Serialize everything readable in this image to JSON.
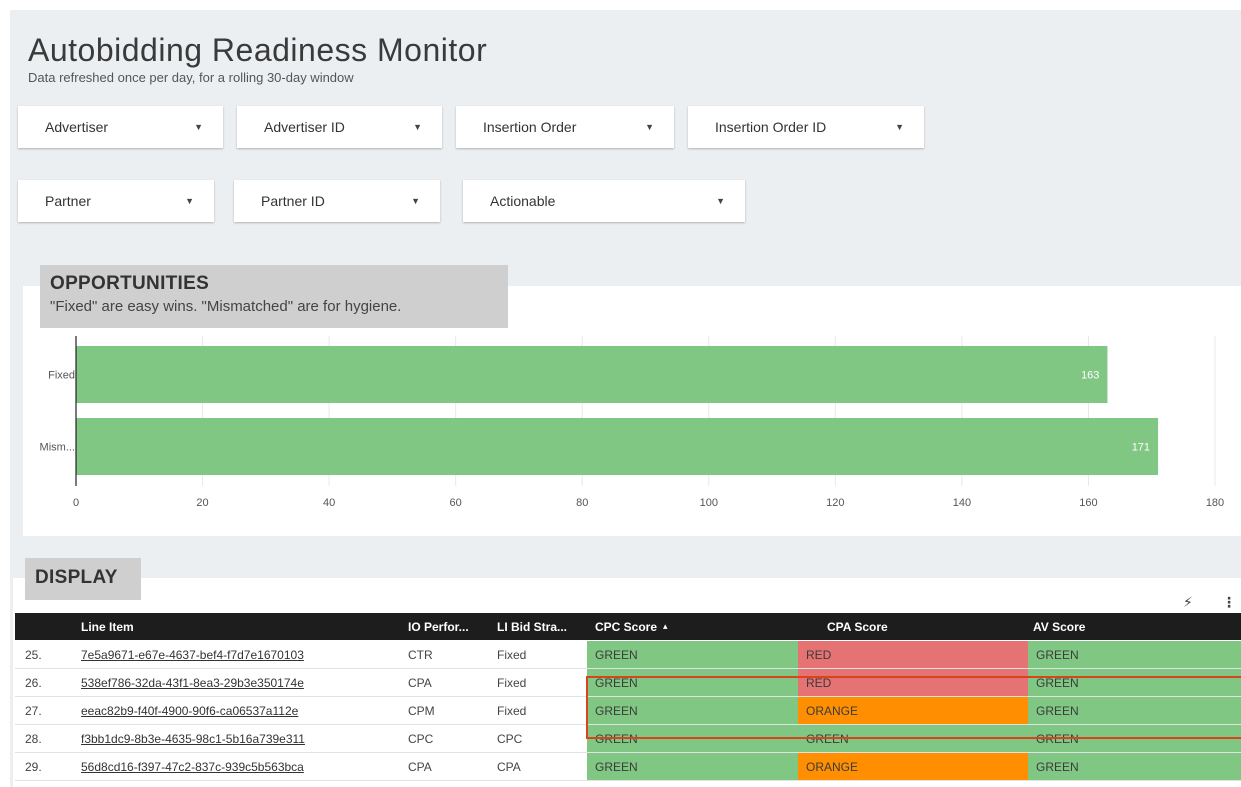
{
  "header": {
    "title": "Autobidding Readiness Monitor",
    "subtitle": "Data refreshed once per day, for a rolling 30-day window"
  },
  "filters": [
    {
      "label": "Advertiser"
    },
    {
      "label": "Advertiser ID"
    },
    {
      "label": "Insertion Order"
    },
    {
      "label": "Insertion Order ID"
    },
    {
      "label": "Partner"
    },
    {
      "label": "Partner ID"
    },
    {
      "label": "Actionable"
    }
  ],
  "opportunities": {
    "heading": "OPPORTUNITIES",
    "note": "\"Fixed\" are easy wins. \"Mismatched\" are for hygiene."
  },
  "chart_data": {
    "type": "bar",
    "orientation": "horizontal",
    "categories": [
      "Fixed",
      "Mism..."
    ],
    "values": [
      163,
      171
    ],
    "xlim": [
      0,
      180
    ],
    "xticks": [
      0,
      20,
      40,
      60,
      80,
      100,
      120,
      140,
      160,
      180
    ],
    "grid": true,
    "data_labels": true,
    "bar_color": "#81c784"
  },
  "display": {
    "heading": "DISPLAY",
    "icons": [
      "bolt-icon",
      "more-vert-icon"
    ],
    "columns": [
      "Line Item",
      "IO Perfor...",
      "LI Bid Stra...",
      "CPC Score",
      "CPA Score",
      "AV Score"
    ],
    "sort_indicator": "▴",
    "rows": [
      {
        "num": "25.",
        "line_item": "7e5a9671-e67e-4637-bef4-f7d7e1670103",
        "io": "CTR",
        "bid": "Fixed",
        "cpc": "GREEN",
        "cpa": "RED",
        "av": "GREEN"
      },
      {
        "num": "26.",
        "line_item": "538ef786-32da-43f1-8ea3-29b3e350174e",
        "io": "CPA",
        "bid": "Fixed",
        "cpc": "GREEN",
        "cpa": "RED",
        "av": "GREEN"
      },
      {
        "num": "27.",
        "line_item": "eeac82b9-f40f-4900-90f6-ca06537a112e",
        "io": "CPM",
        "bid": "Fixed",
        "cpc": "GREEN",
        "cpa": "ORANGE",
        "av": "GREEN"
      },
      {
        "num": "28.",
        "line_item": "f3bb1dc9-8b3e-4635-98c1-5b16a739e311",
        "io": "CPC",
        "bid": "CPC",
        "cpc": "GREEN",
        "cpa": "GREEN",
        "av": "GREEN"
      },
      {
        "num": "29.",
        "line_item": "56d8cd16-f397-47c2-837c-939c5b563bca",
        "io": "CPA",
        "bid": "CPA",
        "cpc": "GREEN",
        "cpa": "ORANGE",
        "av": "GREEN"
      }
    ]
  },
  "colors": {
    "GREEN": "#81c784",
    "RED": "#e57373",
    "ORANGE": "#ff8f00",
    "highlight": "#d9441e"
  }
}
